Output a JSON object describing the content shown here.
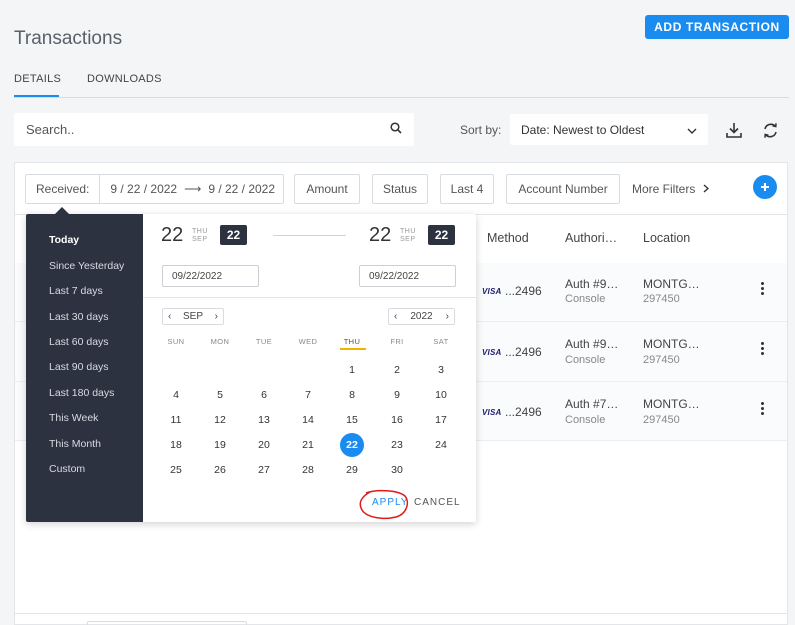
{
  "page": {
    "title": "Transactions",
    "add_button": "ADD TRANSACTION"
  },
  "tabs": [
    {
      "label": "DETAILS",
      "active": true
    },
    {
      "label": "DOWNLOADS",
      "active": false
    }
  ],
  "search": {
    "placeholder": "Search.."
  },
  "sort": {
    "label": "Sort by:",
    "value": "Date: Newest to Oldest"
  },
  "filters": {
    "received_label": "Received:",
    "received_from": "9 / 22 / 2022",
    "arrow": "⟶",
    "received_to": "9 / 22 / 2022",
    "chips": [
      "Amount",
      "Status",
      "Last 4",
      "Account Number"
    ],
    "more": "More Filters"
  },
  "columns": [
    "Method",
    "Authori…",
    "Location"
  ],
  "rows": [
    {
      "card_brand": "VISA",
      "card_last": "...2496",
      "auth": "Auth #9…",
      "source": "Console",
      "location": "MONTG…",
      "location_code": "297450"
    },
    {
      "card_brand": "VISA",
      "card_last": "...2496",
      "auth": "Auth #9…",
      "source": "Console",
      "location": "MONTG…",
      "location_code": "297450"
    },
    {
      "card_brand": "VISA",
      "card_last": "...2496",
      "auth": "Auth #7…",
      "source": "Console",
      "location": "MONTG…",
      "location_code": "297450"
    }
  ],
  "date_picker": {
    "presets": [
      "Today",
      "Since Yesterday",
      "Last 7 days",
      "Last 30 days",
      "Last 60 days",
      "Last 90 days",
      "Last 180 days",
      "This Week",
      "This Month",
      "Custom"
    ],
    "active_preset": "Today",
    "start": {
      "day": "22",
      "dow": "THU",
      "month": "SEP",
      "badge": "22",
      "input": "09/22/2022"
    },
    "end": {
      "day": "22",
      "dow": "THU",
      "month": "SEP",
      "badge": "22",
      "input": "09/22/2022"
    },
    "month_nav": {
      "prev": "‹",
      "label": "SEP",
      "next": "›"
    },
    "year_nav": {
      "prev": "‹",
      "label": "2022",
      "next": "›"
    },
    "weekdays": [
      "SUN",
      "MON",
      "TUE",
      "WED",
      "THU",
      "FRI",
      "SAT"
    ],
    "today_weekday": "THU",
    "first_weekday_index": 4,
    "days_in_month": 30,
    "selected_day": 22,
    "apply": "APPLY",
    "cancel": "CANCEL"
  },
  "colors": {
    "accent": "#1a8cf0",
    "sidebar": "#2c3240",
    "today_underline": "#f0b400",
    "annotation": "#e01a1a"
  },
  "icons": [
    "search-icon",
    "chevron-down-icon",
    "download-icon",
    "refresh-icon",
    "chevron-right-icon",
    "plus-icon",
    "kebab-icon"
  ]
}
